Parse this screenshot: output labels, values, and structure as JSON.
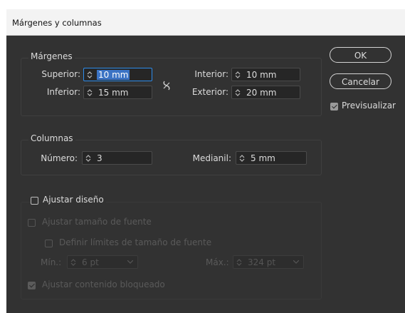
{
  "window": {
    "title": "Márgenes y columnas"
  },
  "margins": {
    "legend": "Márgenes",
    "top_label": "Superior:",
    "top_value": "10 mm",
    "bottom_label": "Inferior:",
    "bottom_value": "15 mm",
    "inside_label": "Interior:",
    "inside_value": "10 mm",
    "outside_label": "Exterior:",
    "outside_value": "20 mm"
  },
  "columns": {
    "legend": "Columnas",
    "number_label": "Número:",
    "number_value": "3",
    "gutter_label": "Medianil:",
    "gutter_value": "5 mm"
  },
  "layout_adjust": {
    "label": "Ajustar diseño",
    "checked": false,
    "font_size_label": "Ajustar tamaño de fuente",
    "font_size_limits_label": "Definir límites de tamaño de fuente",
    "min_label": "Mín.:",
    "min_value": "6 pt",
    "max_label": "Máx.:",
    "max_value": "324 pt",
    "locked_label": "Ajustar contenido bloqueado"
  },
  "buttons": {
    "ok": "OK",
    "cancel": "Cancelar"
  },
  "preview": {
    "label": "Previsualizar",
    "checked": true
  },
  "colors": {
    "dialog_bg": "#323232",
    "focus": "#2d8ceb",
    "selection": "#3b73c4"
  }
}
